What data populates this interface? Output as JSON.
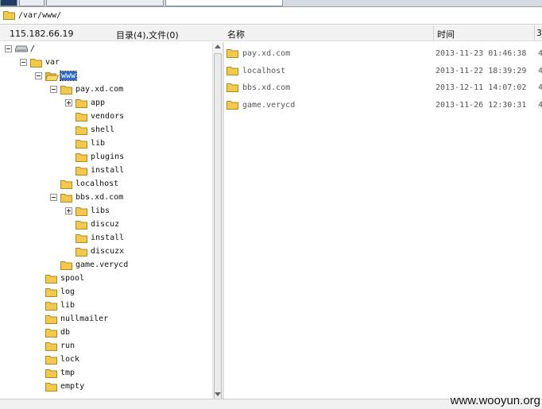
{
  "path_bar": {
    "path": "/var/www/",
    "icon": "folder-icon"
  },
  "header": {
    "server_ip": "115.182.66.19",
    "counts": "目录(4),文件(0)",
    "col_name": "名称",
    "col_time": "时间",
    "col_extra": "3"
  },
  "tree": [
    {
      "label": "/",
      "depth": 0,
      "expander": "minus",
      "icon": "drive-icon",
      "selected": false
    },
    {
      "label": "var",
      "depth": 1,
      "expander": "minus",
      "icon": "folder-icon",
      "selected": false
    },
    {
      "label": "www",
      "depth": 2,
      "expander": "minus",
      "icon": "folder-open-icon",
      "selected": true
    },
    {
      "label": "pay.xd.com",
      "depth": 3,
      "expander": "minus",
      "icon": "folder-icon",
      "selected": false
    },
    {
      "label": "app",
      "depth": 4,
      "expander": "plus",
      "icon": "folder-icon",
      "selected": false
    },
    {
      "label": "vendors",
      "depth": 4,
      "expander": "none",
      "icon": "folder-icon",
      "selected": false
    },
    {
      "label": "shell",
      "depth": 4,
      "expander": "none",
      "icon": "folder-icon",
      "selected": false
    },
    {
      "label": "lib",
      "depth": 4,
      "expander": "none",
      "icon": "folder-icon",
      "selected": false
    },
    {
      "label": "plugins",
      "depth": 4,
      "expander": "none",
      "icon": "folder-icon",
      "selected": false
    },
    {
      "label": "install",
      "depth": 4,
      "expander": "none",
      "icon": "folder-icon",
      "selected": false
    },
    {
      "label": "localhost",
      "depth": 3,
      "expander": "none",
      "icon": "folder-icon",
      "selected": false
    },
    {
      "label": "bbs.xd.com",
      "depth": 3,
      "expander": "minus",
      "icon": "folder-icon",
      "selected": false
    },
    {
      "label": "libs",
      "depth": 4,
      "expander": "plus",
      "icon": "folder-icon",
      "selected": false
    },
    {
      "label": "discuz",
      "depth": 4,
      "expander": "none",
      "icon": "folder-icon",
      "selected": false
    },
    {
      "label": "install",
      "depth": 4,
      "expander": "none",
      "icon": "folder-icon",
      "selected": false
    },
    {
      "label": "discuzx",
      "depth": 4,
      "expander": "none",
      "icon": "folder-icon",
      "selected": false
    },
    {
      "label": "game.verycd",
      "depth": 3,
      "expander": "none",
      "icon": "folder-icon",
      "selected": false
    },
    {
      "label": "spool",
      "depth": 2,
      "expander": "none",
      "icon": "folder-icon",
      "selected": false
    },
    {
      "label": "log",
      "depth": 2,
      "expander": "none",
      "icon": "folder-icon",
      "selected": false
    },
    {
      "label": "lib",
      "depth": 2,
      "expander": "none",
      "icon": "folder-icon",
      "selected": false
    },
    {
      "label": "nullmailer",
      "depth": 2,
      "expander": "none",
      "icon": "folder-icon",
      "selected": false
    },
    {
      "label": "db",
      "depth": 2,
      "expander": "none",
      "icon": "folder-icon",
      "selected": false
    },
    {
      "label": "run",
      "depth": 2,
      "expander": "none",
      "icon": "folder-icon",
      "selected": false
    },
    {
      "label": "lock",
      "depth": 2,
      "expander": "none",
      "icon": "folder-icon",
      "selected": false
    },
    {
      "label": "tmp",
      "depth": 2,
      "expander": "none",
      "icon": "folder-icon",
      "selected": false
    },
    {
      "label": "empty",
      "depth": 2,
      "expander": "none",
      "icon": "folder-icon",
      "selected": false
    }
  ],
  "files": [
    {
      "name": "pay.xd.com",
      "time": "2013-11-23 01:46:38",
      "extra": "4",
      "icon": "folder-icon"
    },
    {
      "name": "localhost",
      "time": "2013-11-22 18:39:29",
      "extra": "4",
      "icon": "folder-icon"
    },
    {
      "name": "bbs.xd.com",
      "time": "2013-12-11 14:07:02",
      "extra": "4",
      "icon": "folder-icon"
    },
    {
      "name": "game.verycd",
      "time": "2013-11-26 12:30:31",
      "extra": "4",
      "icon": "folder-icon"
    }
  ],
  "watermark": "www.wooyun.org",
  "colors": {
    "folder": "#f2c94c",
    "folder_stroke": "#b08a1e",
    "selection": "#316ac5"
  }
}
